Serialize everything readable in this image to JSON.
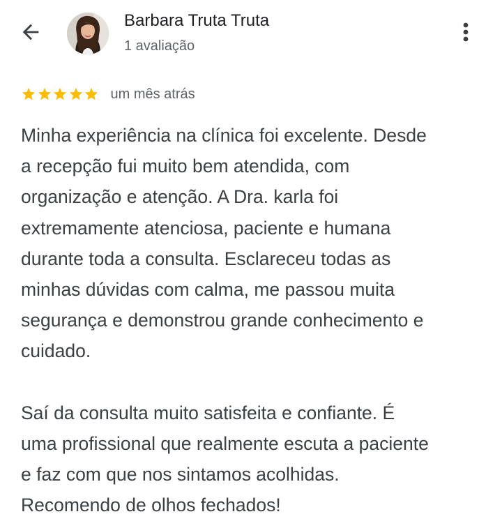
{
  "header": {
    "back_icon": "arrow-back-icon",
    "reviewer_name": "Barbara Truta Truta",
    "review_count": "1 avaliação",
    "more_icon": "more-vert-icon"
  },
  "review": {
    "rating": 5,
    "rating_max": 5,
    "star_color": "#fbbc04",
    "date": "um mês atrás",
    "text": "Minha experiência na clínica foi excelente. Desde\na recepção fui muito bem atendida, com\norganização e atenção. A Dra. karla foi\nextremamente atenciosa, paciente e humana\ndurante toda a consulta. Esclareceu todas as\nminhas dúvidas com calma, me passou muita\nsegurança e demonstrou grande conhecimento e\ncuidado.\n\nSaí da consulta muito satisfeita e confiante. É\numa profissional que realmente escuta a paciente\ne faz com que nos sintamos acolhidas.\nRecomendo de olhos fechados!"
  }
}
